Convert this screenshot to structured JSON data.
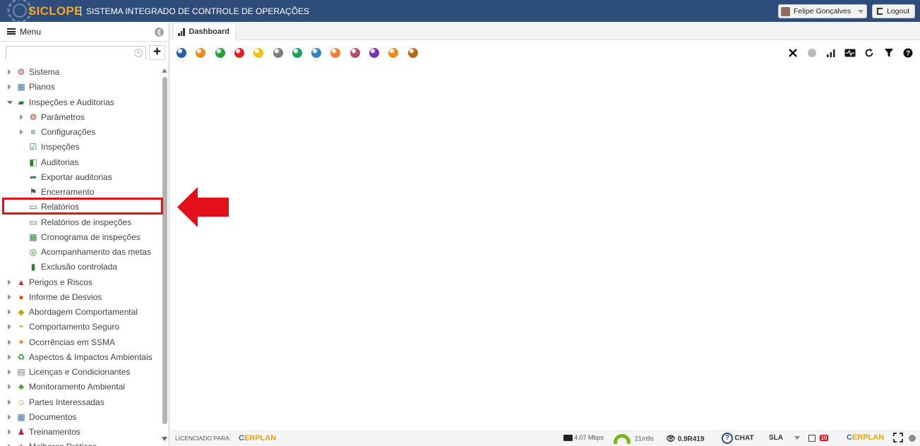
{
  "header": {
    "logo_text": "SICLOPE",
    "app_title": "SISTEMA INTEGRADO DE CONTROLE DE OPERAÇÕES",
    "user_name": "Felipe Gonçalves",
    "logout_label": "Logout",
    "background_color": "#2e4d7b",
    "logo_color": "#f5a623"
  },
  "sidebar": {
    "menu_label": "Menu",
    "search_placeholder": "",
    "items": [
      {
        "label": "Sistema",
        "icon": "gear-icon",
        "level": 0,
        "state": "collapsed"
      },
      {
        "label": "Planos",
        "icon": "calendar-icon",
        "level": 0,
        "state": "collapsed"
      },
      {
        "label": "Inspeções e Auditorias",
        "icon": "folder-open-icon",
        "level": 0,
        "state": "expanded"
      },
      {
        "label": "Parâmetros",
        "icon": "gear-icon",
        "level": 1,
        "state": "collapsed"
      },
      {
        "label": "Configurações",
        "icon": "sliders-icon",
        "level": 1,
        "state": "collapsed"
      },
      {
        "label": "Inspeções",
        "icon": "clipboard-check-icon",
        "level": 1,
        "state": "leaf"
      },
      {
        "label": "Auditorias",
        "icon": "audit-icon",
        "level": 1,
        "state": "leaf"
      },
      {
        "label": "Exportar auditorias",
        "icon": "export-icon",
        "level": 1,
        "state": "leaf"
      },
      {
        "label": "Encerramento",
        "icon": "flag-icon",
        "level": 1,
        "state": "leaf"
      },
      {
        "label": "Relatórios",
        "icon": "pdf-icon",
        "level": 1,
        "state": "leaf"
      },
      {
        "label": "Relatórios de inspeções",
        "icon": "pdf-icon",
        "level": 1,
        "state": "leaf"
      },
      {
        "label": "Cronograma de inspeções",
        "icon": "schedule-icon",
        "level": 1,
        "state": "leaf"
      },
      {
        "label": "Acompanhamento das metas",
        "icon": "target-icon",
        "level": 1,
        "state": "leaf"
      },
      {
        "label": "Exclusão controlada",
        "icon": "trash-icon",
        "level": 1,
        "state": "leaf"
      },
      {
        "label": "Perigos e Riscos",
        "icon": "warning-icon",
        "level": 0,
        "state": "collapsed"
      },
      {
        "label": "Informe de Desvios",
        "icon": "phone-icon",
        "level": 0,
        "state": "collapsed"
      },
      {
        "label": "Abordagem Comportamental",
        "icon": "diamond-icon",
        "level": 0,
        "state": "collapsed"
      },
      {
        "label": "Comportamento Seguro",
        "icon": "helmet-icon",
        "level": 0,
        "state": "collapsed"
      },
      {
        "label": "Ocorrências em SSMA",
        "icon": "falling-person-icon",
        "level": 0,
        "state": "collapsed"
      },
      {
        "label": "Aspectos & Impactos Ambientais",
        "icon": "recycle-icon",
        "level": 0,
        "state": "collapsed"
      },
      {
        "label": "Licenças e Condicionantes",
        "icon": "license-icon",
        "level": 0,
        "state": "collapsed"
      },
      {
        "label": "Monitoramento Ambiental",
        "icon": "tree-icon",
        "level": 0,
        "state": "collapsed"
      },
      {
        "label": "Partes Interessadas",
        "icon": "people-icon",
        "level": 0,
        "state": "collapsed"
      },
      {
        "label": "Documentos",
        "icon": "document-icon",
        "level": 0,
        "state": "collapsed"
      },
      {
        "label": "Treinamentos",
        "icon": "trainer-icon",
        "level": 0,
        "state": "collapsed"
      },
      {
        "label": "Melhores Práticas",
        "icon": "star-icon",
        "level": 0,
        "state": "collapsed"
      }
    ],
    "highlighted_item": "Relatórios",
    "highlight_color": "#e3101a"
  },
  "main": {
    "tab_label": "Dashboard",
    "status_dots": [
      "#1f5fa8",
      "#ef8a1f",
      "#21a33a",
      "#e21f26",
      "#f2c10d",
      "#7d7d7d",
      "#1aa55a",
      "#2a84c6",
      "#ef7d30",
      "#b24a74",
      "#7b2fb8",
      "#f08a16",
      "#b56a12"
    ],
    "toolbar_icons": [
      "close-icon",
      "status-dot-icon",
      "signal-icon",
      "pulse-icon",
      "refresh-icon",
      "filter-icon",
      "help-icon"
    ],
    "arrow_color": "#e3101a"
  },
  "footer": {
    "licensed_label": "LICENCIADO PARA:",
    "brand": "ERPLAN",
    "speed": "4.07 Mbps",
    "session_time": "21m9s",
    "version": "0.9R419",
    "chat_label": "CHAT",
    "sla_label": "SLA",
    "notifications_count": "10"
  }
}
